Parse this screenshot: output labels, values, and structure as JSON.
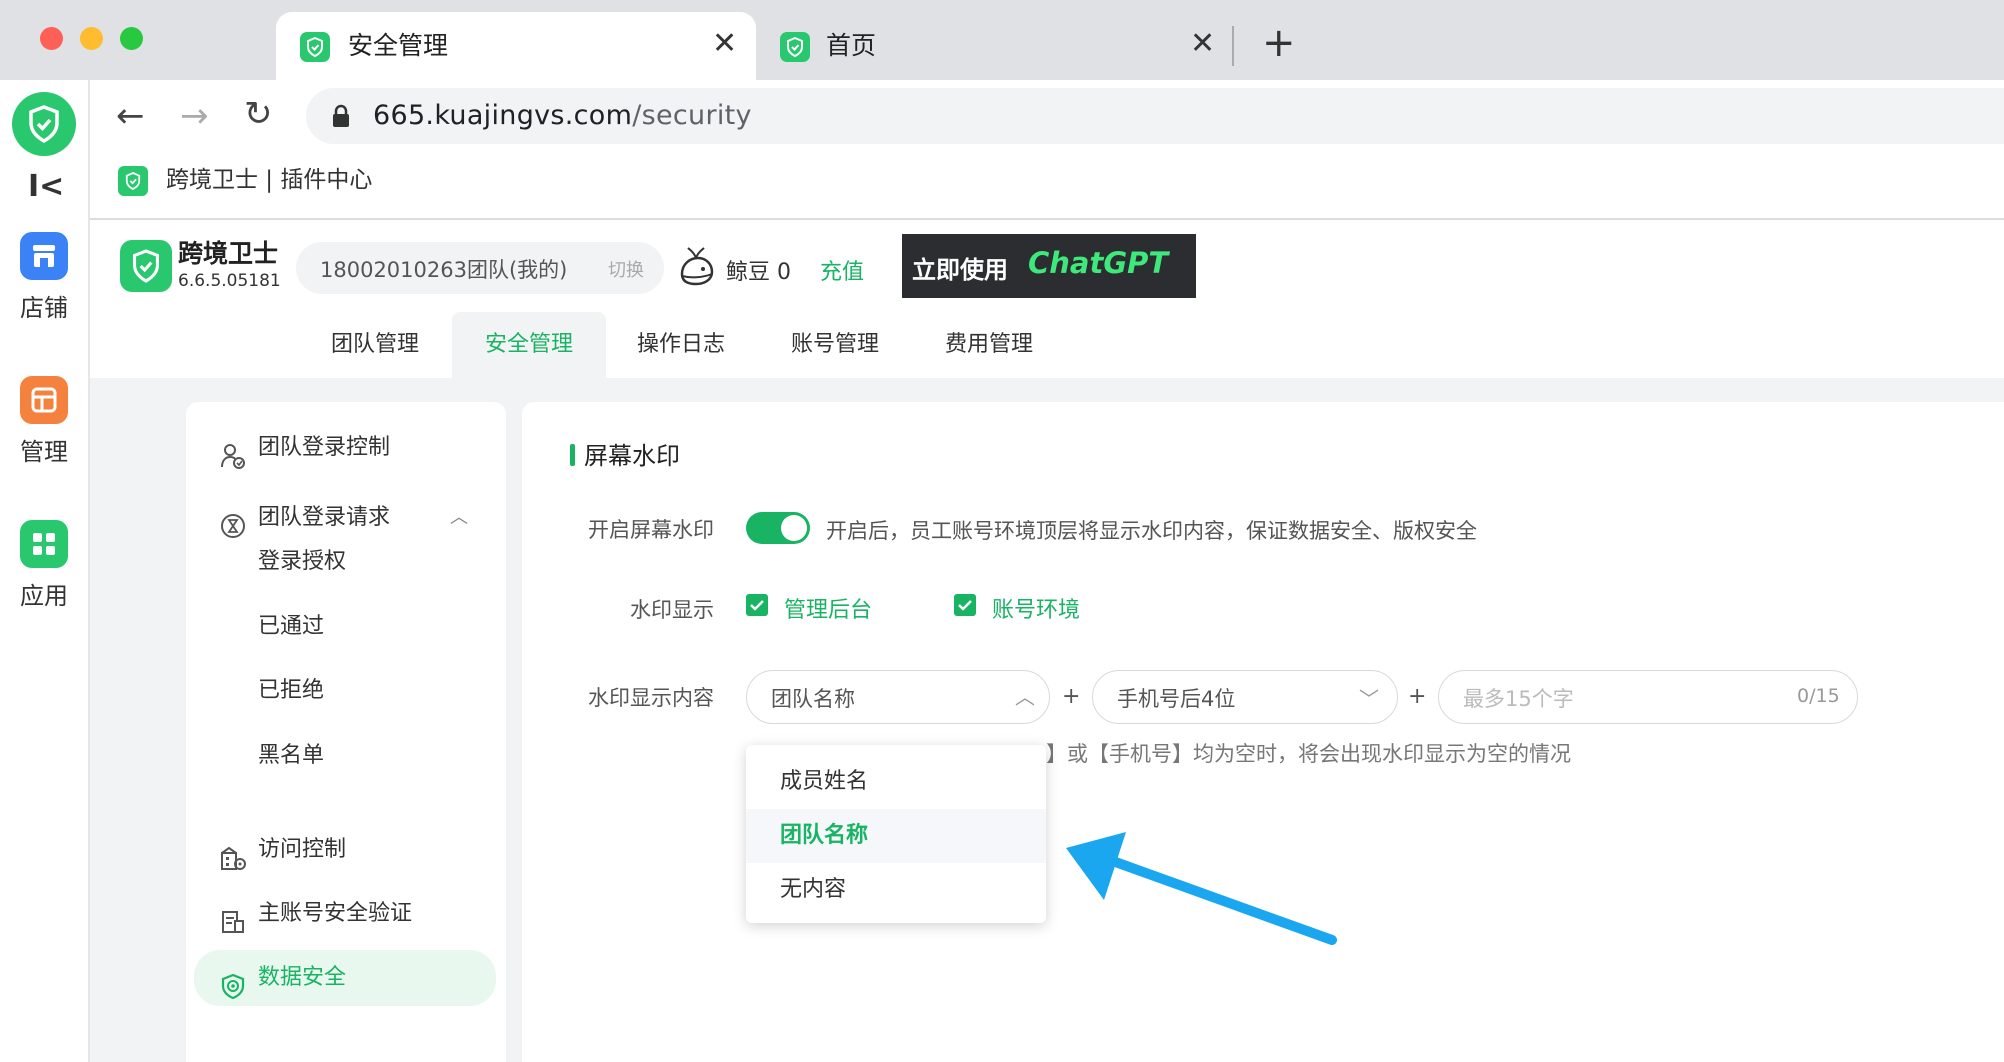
{
  "browser": {
    "tabs": [
      {
        "title": "安全管理",
        "active": true
      },
      {
        "title": "首页",
        "active": false
      }
    ],
    "new_tab_label": "+",
    "url_host": "665.kuajingvs.com",
    "url_path": "/security",
    "bookmark": "跨境卫士 | 插件中心"
  },
  "rail": {
    "items": [
      {
        "label": "店铺",
        "icon": "store-icon",
        "color": "#3b82f6"
      },
      {
        "label": "管理",
        "icon": "layout-icon",
        "color": "#f5813f"
      },
      {
        "label": "应用",
        "icon": "apps-icon",
        "color": "#29c76e"
      }
    ],
    "collapse_label": "I<"
  },
  "header": {
    "brand_name": "跨境卫士",
    "version": "6.6.5.05181",
    "team": "18002010263团队(我的)",
    "switch_label": "切换",
    "beans_label": "鲸豆 0",
    "recharge_label": "充值",
    "banner_text_1": "立即使用",
    "banner_text_2": "ChatGPT",
    "tabs": [
      "团队管理",
      "安全管理",
      "操作日志",
      "账号管理",
      "费用管理"
    ],
    "active_tab": "安全管理"
  },
  "sidemenu": {
    "items": [
      {
        "label": "团队登录控制",
        "icon": "user-lock-icon"
      },
      {
        "label": "团队登录请求",
        "icon": "hourglass-icon",
        "expanded": true
      },
      {
        "label": "访问控制",
        "icon": "building-icon"
      },
      {
        "label": "主账号安全验证",
        "icon": "document-check-icon"
      },
      {
        "label": "数据安全",
        "icon": "shield-check-icon",
        "active": true
      }
    ],
    "subitems": [
      "登录授权",
      "已通过",
      "已拒绝",
      "黑名单"
    ]
  },
  "content": {
    "section_title": "屏幕水印",
    "toggle_label": "开启屏幕水印",
    "toggle_on": true,
    "toggle_desc": "开启后，员工账号环境顶层将显示水印内容，保证数据安全、版权安全",
    "display_label": "水印显示",
    "checkbox_admin": "管理后台",
    "checkbox_env": "账号环境",
    "content_label": "水印显示内容",
    "select1_value": "团队名称",
    "select2_value": "手机号后4位",
    "plus": "+",
    "custom_placeholder": "最多15个字",
    "custom_count": "0/15",
    "hint": "若登陆用户的【姓名】或【手机号】均为空时，将会出现水印显示为空的情况",
    "hint_visible": "】或【手机号】均为空时，将会出现水印显示为空的情况"
  },
  "dropdown": {
    "options": [
      "成员姓名",
      "团队名称",
      "无内容"
    ],
    "selected": "团队名称"
  },
  "colors": {
    "brand_green": "#19b364",
    "arrow_blue": "#1aa7f0"
  }
}
